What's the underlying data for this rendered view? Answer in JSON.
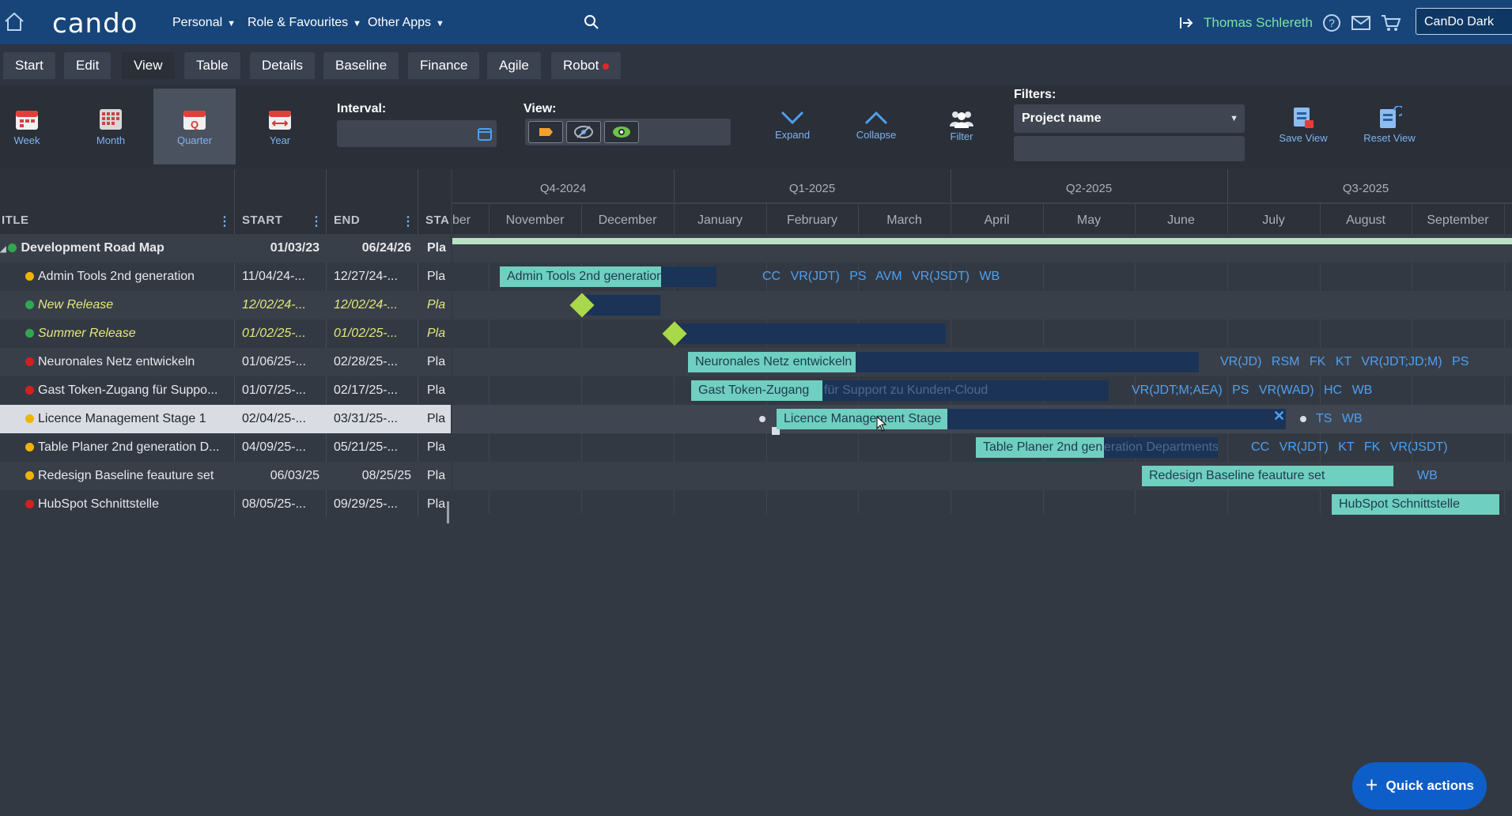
{
  "topbar": {
    "logo": "cando",
    "menus": [
      "Personal",
      "Role & Favourites",
      "Other Apps"
    ],
    "user": "Thomas Schlereth",
    "theme": "CanDo Dark"
  },
  "tabs": [
    "Start",
    "Edit",
    "View",
    "Table",
    "Details",
    "Baseline",
    "Finance",
    "Agile",
    "Robot"
  ],
  "toolbar": {
    "week": "Week",
    "month": "Month",
    "quarter": "Quarter",
    "year": "Year",
    "interval_label": "Interval:",
    "view_label": "View:",
    "expand": "Expand",
    "collapse": "Collapse",
    "filter": "Filter",
    "filters_label": "Filters:",
    "filter_select": "Project name",
    "save_view": "Save View",
    "reset_view": "Reset View"
  },
  "grid": {
    "columns": [
      "ITLE",
      "START",
      "END",
      "STA"
    ],
    "rows": [
      {
        "title": "Development Road Map",
        "start": "01/03/23",
        "end": "06/24/26",
        "status": "Pla",
        "dot": "#2fa84f"
      },
      {
        "title": "Admin Tools 2nd generation",
        "start": "11/04/24-...",
        "end": "12/27/24-...",
        "status": "Pla",
        "dot": "#f0b400"
      },
      {
        "title": "New Release",
        "start": "12/02/24-...",
        "end": "12/02/24-...",
        "status": "Pla",
        "dot": "#2fa84f"
      },
      {
        "title": "Summer Release",
        "start": "01/02/25-...",
        "end": "01/02/25-...",
        "status": "Pla",
        "dot": "#2fa84f"
      },
      {
        "title": "Neuronales Netz entwickeln",
        "start": "01/06/25-...",
        "end": "02/28/25-...",
        "status": "Pla",
        "dot": "#d42020"
      },
      {
        "title": "Gast Token-Zugang für Suppo...",
        "start": "01/07/25-...",
        "end": "02/17/25-...",
        "status": "Pla",
        "dot": "#d42020"
      },
      {
        "title": "Licence Management Stage 1",
        "start": "02/04/25-...",
        "end": "03/31/25-...",
        "status": "Pla",
        "dot": "#f0b400"
      },
      {
        "title": "Table Planer 2nd generation D...",
        "start": "04/09/25-...",
        "end": "05/21/25-...",
        "status": "Pla",
        "dot": "#f0b400"
      },
      {
        "title": "Redesign Baseline feauture set",
        "start": "06/03/25",
        "end": "08/25/25",
        "status": "Pla",
        "dot": "#f0b400"
      },
      {
        "title": "HubSpot Schnittstelle",
        "start": "08/05/25-...",
        "end": "09/29/25-...",
        "status": "Pla",
        "dot": "#d42020"
      }
    ]
  },
  "gantt": {
    "quarters": [
      "Q4-2024",
      "Q1-2025",
      "Q2-2025",
      "Q3-2025"
    ],
    "months": [
      "ber",
      "November",
      "December",
      "January",
      "February",
      "March",
      "April",
      "May",
      "June",
      "July",
      "August",
      "September"
    ],
    "bars": {
      "admin": "Admin Tools 2nd generation",
      "neuro": "Neuronales Netz entwickeln",
      "gast_light": "Gast Token-Zugang",
      "gast_ghost": "für Support zu Kunden-Cloud",
      "licence": "Licence Management Stage",
      "table_light": "Table Planer 2nd gen",
      "table_ghost": "eration Departments",
      "redesign": "Redesign Baseline feauture set",
      "hubspot": "HubSpot Schnittstelle"
    },
    "resources": {
      "admin": [
        "CC",
        "VR(JDT)",
        "PS",
        "AVM",
        "VR(JSDT)",
        "WB"
      ],
      "neuro": [
        "VR(JD)",
        "RSM",
        "FK",
        "KT",
        "VR(JDT;JD;M)",
        "PS"
      ],
      "gast": [
        "VR(JDT;M;AEA)",
        "PS",
        "VR(WAD)",
        "HC",
        "WB"
      ],
      "licence": [
        "TS",
        "WB"
      ],
      "table": [
        "CC",
        "VR(JDT)",
        "KT",
        "FK",
        "VR(JSDT)"
      ],
      "redesign": [
        "WB"
      ]
    },
    "close_symbol": "✕"
  },
  "quick_actions": "Quick actions"
}
